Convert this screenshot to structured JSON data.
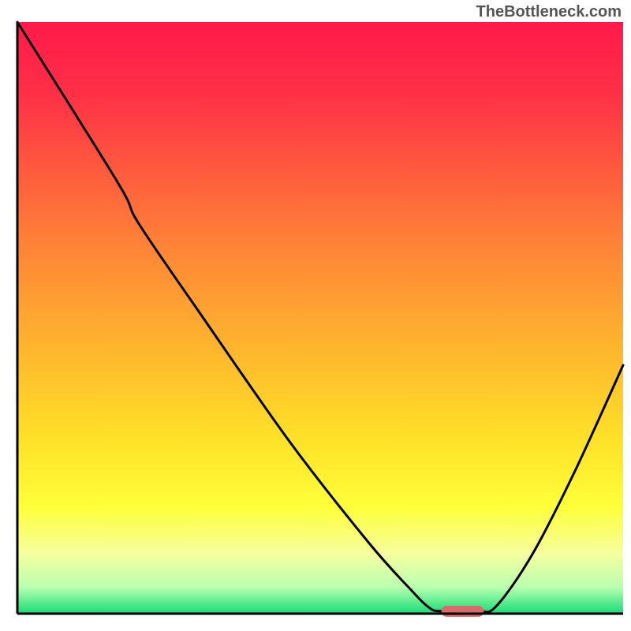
{
  "watermark": "TheBottleneck.com",
  "chart_data": {
    "type": "line",
    "title": "",
    "xlabel": "",
    "ylabel": "",
    "xlim": [
      0,
      100
    ],
    "ylim": [
      0,
      100
    ],
    "background_gradient": {
      "stops": [
        {
          "offset": 0.0,
          "color": "#ff1a4a"
        },
        {
          "offset": 0.12,
          "color": "#ff2f47"
        },
        {
          "offset": 0.25,
          "color": "#ff5a3e"
        },
        {
          "offset": 0.4,
          "color": "#ff8a36"
        },
        {
          "offset": 0.55,
          "color": "#ffb52e"
        },
        {
          "offset": 0.7,
          "color": "#ffe028"
        },
        {
          "offset": 0.82,
          "color": "#ffff3a"
        },
        {
          "offset": 0.9,
          "color": "#f5ffa0"
        },
        {
          "offset": 0.955,
          "color": "#baffb0"
        },
        {
          "offset": 0.985,
          "color": "#4de88a"
        },
        {
          "offset": 1.0,
          "color": "#1bd978"
        }
      ]
    },
    "series": [
      {
        "name": "bottleneck-curve",
        "color": "#000000",
        "points": [
          {
            "x": 0.0,
            "y": 100.0
          },
          {
            "x": 16.5,
            "y": 73.0
          },
          {
            "x": 20.0,
            "y": 66.0
          },
          {
            "x": 30.0,
            "y": 51.0
          },
          {
            "x": 45.0,
            "y": 29.0
          },
          {
            "x": 58.0,
            "y": 12.0
          },
          {
            "x": 65.0,
            "y": 4.0
          },
          {
            "x": 68.0,
            "y": 1.0
          },
          {
            "x": 70.0,
            "y": 0.4
          },
          {
            "x": 76.0,
            "y": 0.4
          },
          {
            "x": 79.0,
            "y": 1.2
          },
          {
            "x": 85.0,
            "y": 10.0
          },
          {
            "x": 92.0,
            "y": 24.0
          },
          {
            "x": 100.0,
            "y": 42.0
          }
        ]
      }
    ],
    "marker": {
      "name": "optimal-range",
      "color": "#d96a6a",
      "x_start": 70.0,
      "x_end": 77.0,
      "y": 0.4
    },
    "axes": {
      "color": "#000000",
      "width": 3,
      "show_left": true,
      "show_bottom": true
    }
  }
}
